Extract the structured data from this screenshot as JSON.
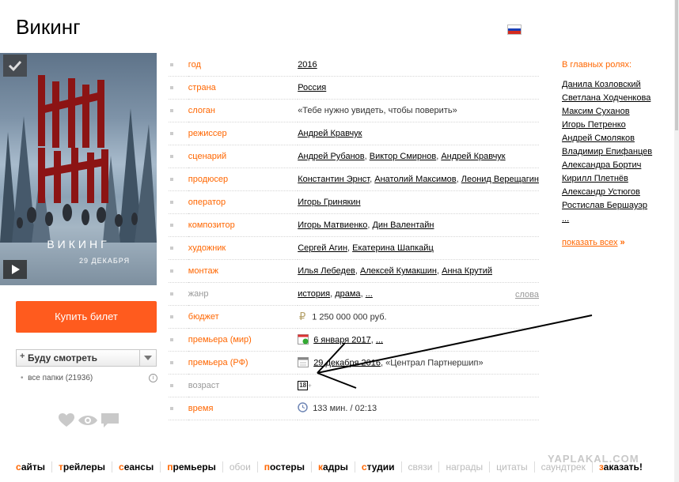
{
  "film": {
    "title": "Викинг"
  },
  "poster": {
    "tagline": "ТЕБЕ НУЖНО УВИДЕТЬ, ЧТОБЫ ПОВЕРИТЬ",
    "title": "ВИКИНГ",
    "date": "29 ДЕКАБРЯ"
  },
  "colors": {
    "accent": "#ff6600",
    "buy": "#ff5b1e"
  },
  "buy_label": "Купить билет",
  "watch": {
    "label": "Буду смотреть",
    "folders": "все папки (21936)"
  },
  "info": {
    "year": {
      "key": "год",
      "links": [
        "2016"
      ]
    },
    "country": {
      "key": "страна",
      "links": [
        "Россия"
      ]
    },
    "slogan": {
      "key": "слоган",
      "text": "«Тебе нужно увидеть, чтобы поверить»"
    },
    "director": {
      "key": "режиссер",
      "links": [
        "Андрей Кравчук"
      ]
    },
    "writer": {
      "key": "сценарий",
      "links": [
        "Андрей Рубанов",
        "Виктор Смирнов",
        "Андрей Кравчук"
      ]
    },
    "producer": {
      "key": "продюсер",
      "links": [
        "Константин Эрнст",
        "Анатолий Максимов",
        "Леонид Верещагин"
      ]
    },
    "operator": {
      "key": "оператор",
      "links": [
        "Игорь Гринякин"
      ]
    },
    "composer": {
      "key": "композитор",
      "links": [
        "Игорь Матвиенко",
        "Дин Валентайн"
      ]
    },
    "artist": {
      "key": "художник",
      "links": [
        "Сергей Агин",
        "Екатерина Шапкайц"
      ]
    },
    "editing": {
      "key": "монтаж",
      "links": [
        "Илья Лебедев",
        "Алексей Кумакшин",
        "Анна Крутий"
      ]
    },
    "genre": {
      "key": "жанр",
      "links": [
        "история",
        "драма",
        "..."
      ],
      "more": "слова"
    },
    "budget": {
      "key": "бюджет",
      "text": "1 250 000 000 руб."
    },
    "premiere_world": {
      "key": "премьера (мир)",
      "date": "6 января 2017",
      "more": "..."
    },
    "premiere_rf": {
      "key": "премьера (РФ)",
      "date": "29 декабря 2016",
      "distributor": "«Централ Партнершип»"
    },
    "age": {
      "key": "возраст",
      "value": "18",
      "plus": "+"
    },
    "time": {
      "key": "время",
      "text": "133 мин. / 02:13"
    }
  },
  "roles": {
    "heading": "В главных ролях:",
    "actors": [
      "Данила Козловский",
      "Светлана Ходченкова",
      "Максим Суханов",
      "Игорь Петренко",
      "Андрей Смоляков",
      "Владимир Епифанцев",
      "Александра Бортич",
      "Кирилл Плетнёв",
      "Александр Устюгов",
      "Ростислав Бершауэр",
      "..."
    ],
    "show_all": "показать всех",
    "show_all_arrow": "»"
  },
  "bottom_nav": [
    {
      "first": "с",
      "rest": "айты",
      "on": true
    },
    {
      "first": "т",
      "rest": "рейлеры",
      "on": true
    },
    {
      "first": "с",
      "rest": "еансы",
      "on": true
    },
    {
      "first": "п",
      "rest": "ремьеры",
      "on": true
    },
    {
      "first": "",
      "rest": "обои",
      "on": false
    },
    {
      "first": "п",
      "rest": "остеры",
      "on": true
    },
    {
      "first": "к",
      "rest": "адры",
      "on": true
    },
    {
      "first": "с",
      "rest": "тудии",
      "on": true
    },
    {
      "first": "",
      "rest": "связи",
      "on": false
    },
    {
      "first": "",
      "rest": "награды",
      "on": false
    },
    {
      "first": "",
      "rest": "цитаты",
      "on": false
    },
    {
      "first": "",
      "rest": "саундтрек",
      "on": false
    },
    {
      "first": "з",
      "rest": "аказать!",
      "on": true
    }
  ],
  "watermark": "YAPLAKAL.COM"
}
